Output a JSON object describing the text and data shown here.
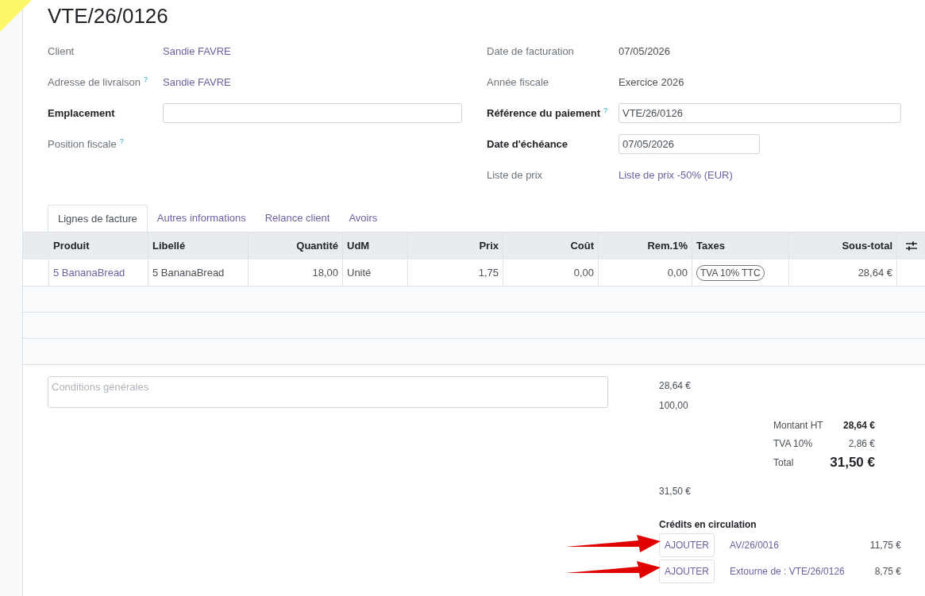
{
  "title": "VTE/26/0126",
  "fields_left": [
    {
      "label": "Client",
      "value": "Sandie FAVRE",
      "kind": "link",
      "required": false
    },
    {
      "label": "Adresse de livraison",
      "help": "?",
      "value": "Sandie FAVRE",
      "kind": "link",
      "required": false
    },
    {
      "label": "Emplacement",
      "kind": "input",
      "required": true
    },
    {
      "label": "Position fiscale",
      "help": "?",
      "kind": "empty",
      "required": false
    }
  ],
  "fields_right": [
    {
      "label": "Date de facturation",
      "value": "07/05/2026",
      "kind": "text",
      "required": false
    },
    {
      "label": "Année fiscale",
      "value": "Exercice 2026",
      "kind": "text",
      "required": false
    },
    {
      "label": "Référence du paiement",
      "help": "?",
      "value": "VTE/26/0126",
      "kind": "input",
      "required": true
    },
    {
      "label": "Date d'échéance",
      "value": "07/05/2026",
      "kind": "short_input",
      "required": true
    },
    {
      "label": "Liste de prix",
      "value": "Liste de prix -50% (EUR)",
      "kind": "link",
      "required": false
    }
  ],
  "tabs": [
    {
      "label": "Lignes de facture",
      "selected": true
    },
    {
      "label": "Autres informations",
      "selected": false
    },
    {
      "label": "Relance client",
      "selected": false
    },
    {
      "label": "Avoirs",
      "selected": false
    }
  ],
  "table": {
    "columns": [
      {
        "label": "Produit",
        "kind": "link"
      },
      {
        "label": "Libellé",
        "kind": "text"
      },
      {
        "label": "Quantité",
        "kind": "number"
      },
      {
        "label": "UdM",
        "kind": "text"
      },
      {
        "label": "Prix",
        "kind": "number"
      },
      {
        "label": "Coût",
        "kind": "number"
      },
      {
        "label": "Rem.1%",
        "kind": "number"
      },
      {
        "label": "Taxes",
        "kind": "tag"
      },
      {
        "label": "Sous-total",
        "kind": "number"
      }
    ],
    "rows": [
      [
        "5 BananaBread",
        "5 BananaBread",
        "18,00",
        "Unité",
        "1,75",
        "0,00",
        "0,00",
        "TVA 10% TTC",
        "28,64 €"
      ]
    ]
  },
  "notes": {
    "placeholder": "Conditions générales"
  },
  "side_values": [
    "28,64 €",
    "100,00"
  ],
  "totals": [
    {
      "label": "Montant HT",
      "value": "28,64 €",
      "kind": "subtotal"
    },
    {
      "label": "TVA 10%",
      "value": "2,86 €",
      "kind": "tax"
    },
    {
      "label": "Total",
      "value": "31,50 €",
      "kind": "grand"
    }
  ],
  "after_total": "31,50 €",
  "credits": {
    "title": "Crédits en circulation",
    "items": [
      {
        "button": "AJOUTER",
        "ref": "AV/26/0016",
        "amount": "11,75 €"
      },
      {
        "button": "AJOUTER",
        "ref": "Extourne de : VTE/26/0126",
        "amount": "8,75 €"
      }
    ]
  }
}
